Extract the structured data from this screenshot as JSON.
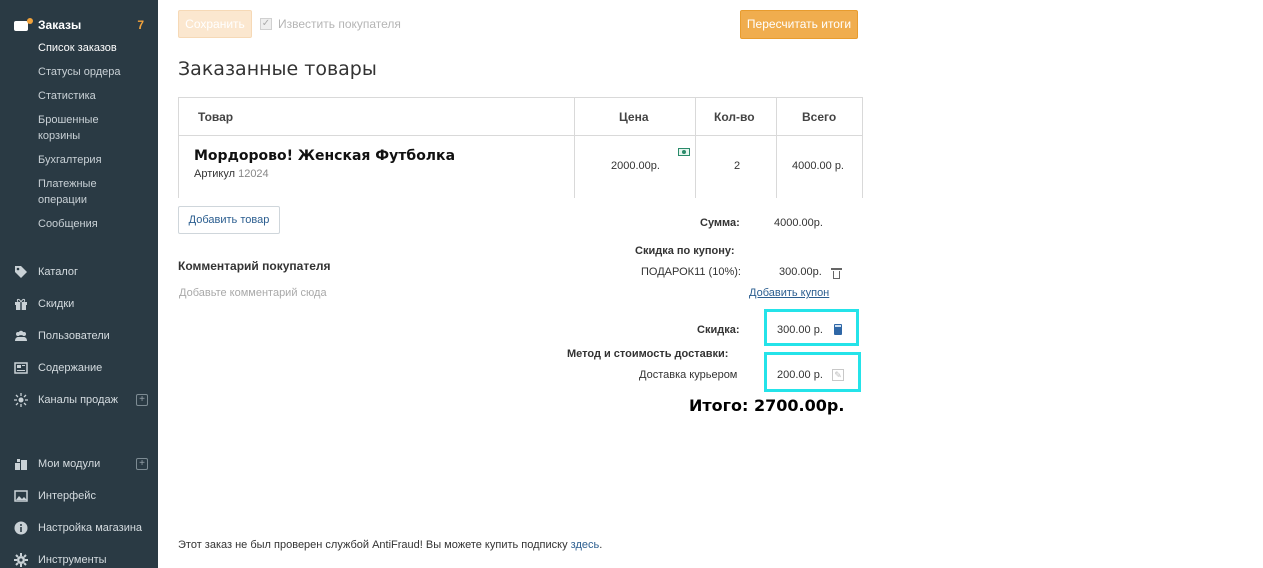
{
  "sidebar": {
    "orders": {
      "label": "Заказы",
      "count": "7"
    },
    "orders_sub": [
      "Список заказов",
      "Статусы ордера",
      "Статистика",
      "Брошенные корзины",
      "Бухгалтерия",
      "Платежные операции",
      "Сообщения"
    ],
    "items": [
      {
        "label": "Каталог",
        "icon": "tag-icon"
      },
      {
        "label": "Скидки",
        "icon": "gift-icon"
      },
      {
        "label": "Пользователи",
        "icon": "users-icon"
      },
      {
        "label": "Содержание",
        "icon": "content-icon"
      },
      {
        "label": "Каналы продаж",
        "icon": "channels-icon"
      },
      {
        "label": "Мои модули",
        "icon": "modules-icon"
      },
      {
        "label": "Интерфейс",
        "icon": "image-icon"
      },
      {
        "label": "Настройка магазина",
        "icon": "info-icon"
      },
      {
        "label": "Инструменты",
        "icon": "gear-icon"
      }
    ],
    "plus_glyph": "+"
  },
  "toolbar": {
    "save_label": "Сохранить",
    "notify_label": "Известить покупателя",
    "recalc_label": "Пересчитать итоги"
  },
  "page_title": "Заказанные товары",
  "table": {
    "headers": [
      "Товар",
      "Цена",
      "Кол-во",
      "Всего"
    ],
    "row": {
      "name": "Мордорово! Женская Футболка",
      "sku_label": "Артикул",
      "sku": "12024",
      "price": "2000.00р.",
      "qty": "2",
      "total": "4000.00 р."
    }
  },
  "add_product_label": "Добавить товар",
  "comment": {
    "title": "Комментарий покупателя",
    "placeholder": "Добавьте комментарий сюда"
  },
  "summary": {
    "sum_label": "Сумма:",
    "sum_value": "4000.00р.",
    "coupon_label": "Скидка по купону:",
    "coupon_name": "ПОДАРОК11 (10%):",
    "coupon_value": "300.00р.",
    "add_coupon": "Добавить купон",
    "discount_label": "Скидка:",
    "discount_value": "300.00 р.",
    "delivery_label": "Метод и стоимость доставки:",
    "delivery_method": "Доставка курьером",
    "delivery_value": "200.00 р.",
    "total_label": "Итого:",
    "total_value": "2700.00р."
  },
  "footer": {
    "text": "Этот заказ не был проверен службой AntiFraud! Вы можете купить подписку",
    "link": "здесь",
    "end": "."
  },
  "colors": {
    "sidebar_bg": "#2a3a44",
    "accent_orange": "#f0ad4e",
    "highlight_cyan": "#24e3e9",
    "link_blue": "#2a5d8f"
  }
}
